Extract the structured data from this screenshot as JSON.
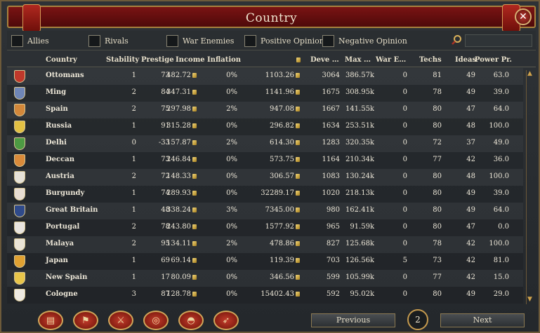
{
  "window": {
    "title": "Country"
  },
  "filters": [
    {
      "label": "Allies"
    },
    {
      "label": "Rivals"
    },
    {
      "label": "War Enemies"
    },
    {
      "label": "Positive Opinion"
    },
    {
      "label": "Negative Opinion"
    }
  ],
  "columns": {
    "country": "Country",
    "stability": "Stability",
    "prestige": "Prestige",
    "income": "Income",
    "inflation": "Inflation",
    "treasury": "",
    "development": "Deve …",
    "max_manpower": "Max …",
    "war_exhaustion": "War E…",
    "techs": "Techs",
    "ideas": "Ideas",
    "power_projection": "Power Pr."
  },
  "rows": [
    {
      "country": "Ottomans",
      "stability": "1",
      "prestige": "73",
      "income": "482.72",
      "inflation": "0%",
      "treasury": "1103.26",
      "development": "3064",
      "max_manpower": "386.57k",
      "war_exhaustion": "0",
      "techs": "81",
      "ideas": "49",
      "power_projection": "63.0",
      "flag_color": "#c0392b"
    },
    {
      "country": "Ming",
      "stability": "2",
      "prestige": "84",
      "income": "347.31",
      "inflation": "0%",
      "treasury": "1141.96",
      "development": "1675",
      "max_manpower": "308.95k",
      "war_exhaustion": "0",
      "techs": "78",
      "ideas": "49",
      "power_projection": "39.0",
      "flag_color": "#6f86b6"
    },
    {
      "country": "Spain",
      "stability": "2",
      "prestige": "75",
      "income": "297.98",
      "inflation": "2%",
      "treasury": "947.08",
      "development": "1667",
      "max_manpower": "141.55k",
      "war_exhaustion": "0",
      "techs": "80",
      "ideas": "47",
      "power_projection": "64.0",
      "flag_color": "#d2873a"
    },
    {
      "country": "Russia",
      "stability": "1",
      "prestige": "91",
      "income": "315.28",
      "inflation": "0%",
      "treasury": "296.82",
      "development": "1634",
      "max_manpower": "253.51k",
      "war_exhaustion": "0",
      "techs": "80",
      "ideas": "48",
      "power_projection": "100.0",
      "flag_color": "#e2c043"
    },
    {
      "country": "Delhi",
      "stability": "0",
      "prestige": "-33",
      "income": "157.87",
      "inflation": "2%",
      "treasury": "614.30",
      "development": "1283",
      "max_manpower": "320.35k",
      "war_exhaustion": "0",
      "techs": "72",
      "ideas": "37",
      "power_projection": "49.0",
      "flag_color": "#4d9a43"
    },
    {
      "country": "Deccan",
      "stability": "1",
      "prestige": "73",
      "income": "246.84",
      "inflation": "0%",
      "treasury": "573.75",
      "development": "1164",
      "max_manpower": "210.34k",
      "war_exhaustion": "0",
      "techs": "77",
      "ideas": "42",
      "power_projection": "36.0",
      "flag_color": "#d98a3a"
    },
    {
      "country": "Austria",
      "stability": "2",
      "prestige": "72",
      "income": "148.33",
      "inflation": "0%",
      "treasury": "306.57",
      "development": "1083",
      "max_manpower": "130.24k",
      "war_exhaustion": "0",
      "techs": "80",
      "ideas": "48",
      "power_projection": "100.0",
      "flag_color": "#e6e2d8"
    },
    {
      "country": "Burgundy",
      "stability": "1",
      "prestige": "74",
      "income": "289.93",
      "inflation": "0%",
      "treasury": "32289.17",
      "development": "1020",
      "max_manpower": "218.13k",
      "war_exhaustion": "0",
      "techs": "80",
      "ideas": "49",
      "power_projection": "39.0",
      "flag_color": "#e7ddd2"
    },
    {
      "country": "Great Britain",
      "stability": "1",
      "prestige": "48",
      "income": "338.24",
      "inflation": "3%",
      "treasury": "7345.00",
      "development": "980",
      "max_manpower": "162.41k",
      "war_exhaustion": "0",
      "techs": "80",
      "ideas": "49",
      "power_projection": "64.0",
      "flag_color": "#2f4a8a"
    },
    {
      "country": "Portugal",
      "stability": "2",
      "prestige": "78",
      "income": "243.80",
      "inflation": "0%",
      "treasury": "1577.92",
      "development": "965",
      "max_manpower": "91.59k",
      "war_exhaustion": "0",
      "techs": "80",
      "ideas": "47",
      "power_projection": "0.0",
      "flag_color": "#e9e5e0"
    },
    {
      "country": "Malaya",
      "stability": "2",
      "prestige": "95",
      "income": "134.11",
      "inflation": "2%",
      "treasury": "478.86",
      "development": "827",
      "max_manpower": "125.68k",
      "war_exhaustion": "0",
      "techs": "78",
      "ideas": "42",
      "power_projection": "100.0",
      "flag_color": "#eae4d6"
    },
    {
      "country": "Japan",
      "stability": "1",
      "prestige": "69",
      "income": "69.14",
      "inflation": "0%",
      "treasury": "119.39",
      "development": "703",
      "max_manpower": "126.56k",
      "war_exhaustion": "5",
      "techs": "73",
      "ideas": "42",
      "power_projection": "81.0",
      "flag_color": "#e0a132"
    },
    {
      "country": "New Spain",
      "stability": "1",
      "prestige": "17",
      "income": "80.09",
      "inflation": "0%",
      "treasury": "346.56",
      "development": "599",
      "max_manpower": "105.99k",
      "war_exhaustion": "0",
      "techs": "77",
      "ideas": "42",
      "power_projection": "15.0",
      "flag_color": "#e8c54a"
    },
    {
      "country": "Cologne",
      "stability": "3",
      "prestige": "87",
      "income": "128.78",
      "inflation": "0%",
      "treasury": "15402.43",
      "development": "592",
      "max_manpower": "95.02k",
      "war_exhaustion": "0",
      "techs": "80",
      "ideas": "49",
      "power_projection": "29.0",
      "flag_color": "#eeeae2"
    }
  ],
  "footer": {
    "previous_label": "Previous",
    "next_label": "Next",
    "page": "2"
  },
  "icons": {
    "close": "close-icon",
    "search": "search-icon",
    "ducat": "ducat-icon"
  }
}
